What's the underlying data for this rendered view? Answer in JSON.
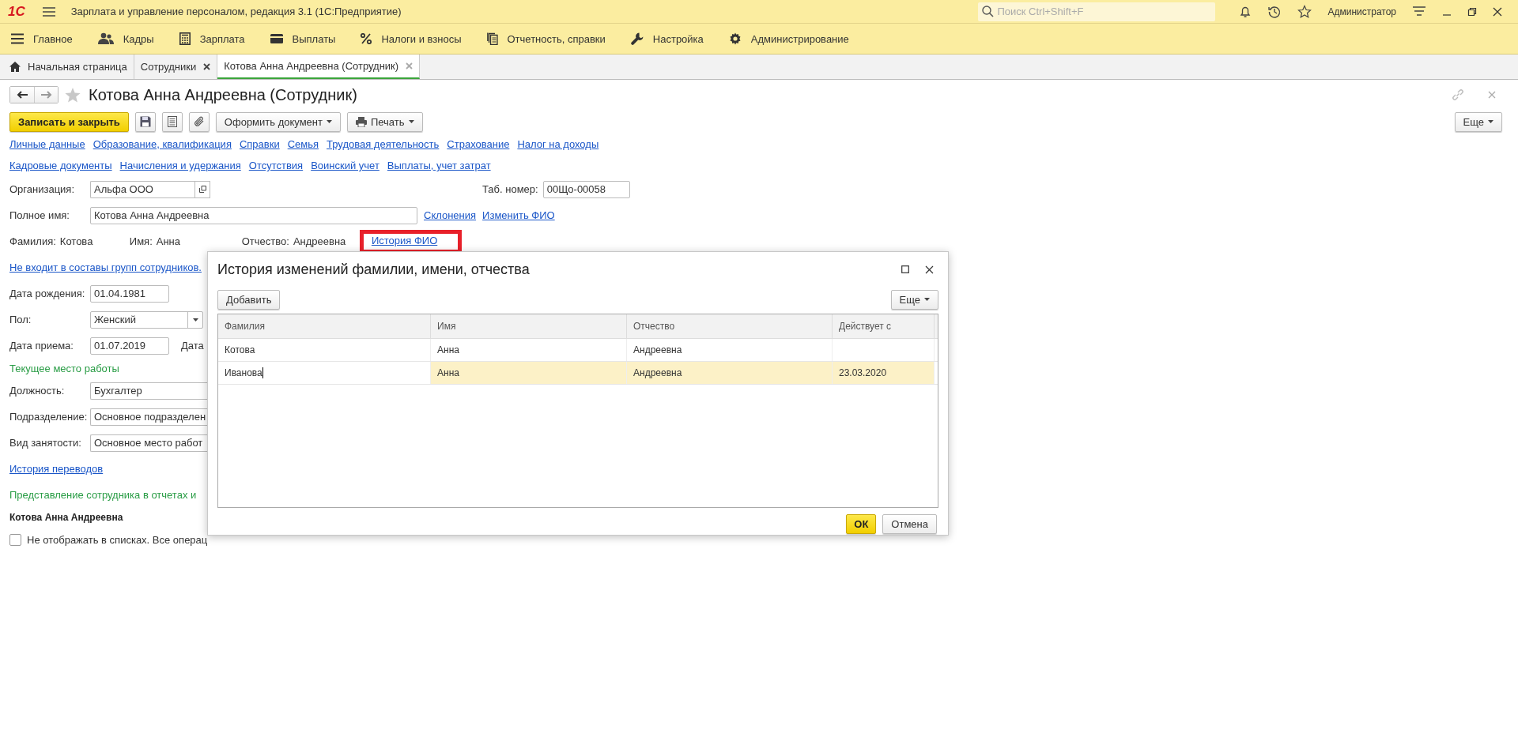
{
  "window": {
    "logo": "1С",
    "title": "Зарплата и управление персоналом, редакция 3.1  (1С:Предприятие)",
    "search": {
      "placeholder": "Поиск Ctrl+Shift+F"
    },
    "user": "Администратор"
  },
  "sections": [
    {
      "label": "Главное",
      "kind": "menu"
    },
    {
      "label": "Кадры",
      "kind": "people"
    },
    {
      "label": "Зарплата",
      "kind": "calculator"
    },
    {
      "label": "Выплаты",
      "kind": "wallet"
    },
    {
      "label": "Налоги и взносы",
      "kind": "percent"
    },
    {
      "label": "Отчетность, справки",
      "kind": "docs"
    },
    {
      "label": "Настройка",
      "kind": "wrench"
    },
    {
      "label": "Администрирование",
      "kind": "gear"
    }
  ],
  "tabs": [
    {
      "label": "Начальная страница",
      "selected": false
    },
    {
      "label": "Сотрудники",
      "selected": false
    },
    {
      "label": "Котова Анна Андреевна (Сотрудник)",
      "selected": true
    }
  ],
  "form": {
    "title": "Котова Анна Андреевна (Сотрудник)",
    "starred": false,
    "save_close": "Записать и закрыть",
    "make_document": "Оформить документ",
    "print": "Печать",
    "more": "Еще",
    "link_rows": [
      [
        "Личные данные",
        "Образование, квалификация",
        "Справки",
        "Семья",
        "Трудовая деятельность",
        "Страхование",
        "Налог на доходы"
      ],
      [
        "Кадровые документы",
        "Начисления и удержания",
        "Отсутствия",
        "Воинский учет",
        "Выплаты, учет затрат"
      ]
    ],
    "organization": {
      "label": "Организация:",
      "value": "Альфа ООО"
    },
    "tab_number": {
      "label": "Таб. номер:",
      "value": "00Що-00058"
    },
    "full_name": {
      "label": "Полное имя:",
      "value": "Котова Анна Андреевна"
    },
    "name_links": [
      "Склонения",
      "Изменить ФИО"
    ],
    "name_parts": [
      {
        "label": "Фамилия:",
        "value": "Котова"
      },
      {
        "label": "Имя:",
        "value": "Анна"
      },
      {
        "label": "Отчество:",
        "value": "Андреевна"
      }
    ],
    "history_link": {
      "label": "История ФИО",
      "highlighted": true
    },
    "groups_link": "Не входит в составы групп сотрудников.",
    "fields": [
      {
        "kind": "date",
        "label": "Дата рождения:",
        "value": "01.04.1981"
      },
      {
        "kind": "select",
        "label": "Пол:",
        "value": "Женский"
      },
      {
        "kind": "date",
        "label": "Дата приема:",
        "value": "01.07.2019",
        "side_label": "Дата"
      }
    ],
    "current_place": {
      "heading": "Текущее место работы",
      "fields": [
        {
          "label": "Должность:",
          "value": "Бухгалтер"
        },
        {
          "label": "Подразделение:",
          "value": "Основное подразделен"
        },
        {
          "label": "Вид занятости:",
          "value": "Основное место работ"
        }
      ]
    },
    "transfers_link": "История переводов",
    "representation": {
      "heading": "Представление сотрудника в отчетах и",
      "value": "Котова Анна Андреевна"
    },
    "hide_in_lists": {
      "label": "Не отображать в списках. Все операц",
      "checked": false
    }
  },
  "dialog": {
    "title": "История изменений фамилии, имени, отчества",
    "add": "Добавить",
    "more": "Еще",
    "columns": [
      "Фамилия",
      "Имя",
      "Отчество",
      "Действует с"
    ],
    "rows": [
      {
        "cells": [
          "Котова",
          "Анна",
          "Андреевна"
        ],
        "selected": false,
        "editing": false
      },
      {
        "cells": [
          "Иванова",
          "Анна",
          "Андреевна",
          "23.03.2020"
        ],
        "selected": true,
        "editing": true
      }
    ],
    "ok": "ОК",
    "cancel": "Отмена"
  }
}
